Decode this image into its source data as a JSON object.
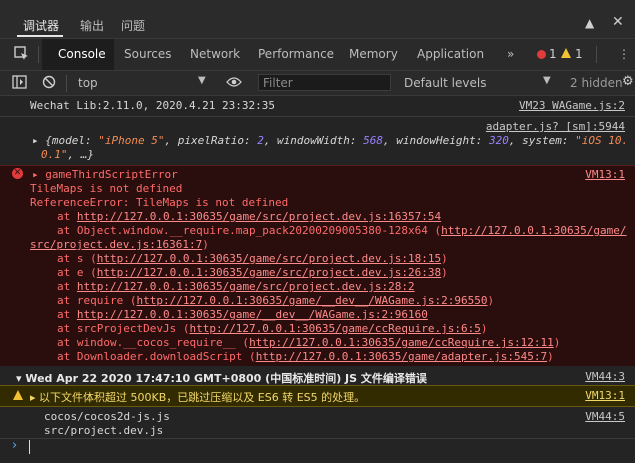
{
  "panel_tabs": [
    "调试器",
    "输出",
    "问题"
  ],
  "panel_icons": {
    "expand": "chevron-up-icon",
    "close": "close-icon"
  },
  "devtools": {
    "tabs": [
      "Console",
      "Sources",
      "Network",
      "Performance",
      "Memory",
      "Application"
    ],
    "error_count": "1",
    "warning_count": "1",
    "more": "⋮"
  },
  "filter_bar": {
    "context": "top",
    "filter_placeholder": "Filter",
    "levels": "Default levels",
    "hidden": "2 hidden"
  },
  "logs": {
    "lib_line": "Wechat Lib:2.11.0, 2020.4.21 23:32:35",
    "lib_src": "VM23 WAGame.js:2",
    "adapter_src": "adapter.js? [sm]:5944",
    "obj_prefix": "▸ {model: ",
    "obj_model": "\"iPhone 5\"",
    "obj_mid1": ", pixelRatio: ",
    "obj_ratio": "2",
    "obj_mid2": ", windowWidth: ",
    "obj_width": "568",
    "obj_mid3": ", windowHeight: ",
    "obj_height": "320",
    "obj_mid4": ", system: ",
    "obj_system": "\"iOS 10.",
    "obj_tail_val": "0.1\"",
    "obj_tail": ", …}",
    "error": {
      "title": "▸ gameThirdScriptError",
      "src": "VM13:1",
      "msg1": "TileMaps is not defined",
      "msg2": "ReferenceError: TileMaps is not defined",
      "s1_pre": "at ",
      "s1_link": "http://127.0.0.1:30635/game/src/project.dev.js:16357:54",
      "s2_pre": "at Object.window.__require.map_pack20200209005380-128x64 (",
      "s2_link": "http://127.0.0.1:30635/game/",
      "s2b_link": "src/project.dev.js:16361:7",
      "s2b_post": ")",
      "s3_pre": "at s (",
      "s3_link": "http://127.0.0.1:30635/game/src/project.dev.js:18:15",
      "s3_post": ")",
      "s4_pre": "at e (",
      "s4_link": "http://127.0.0.1:30635/game/src/project.dev.js:26:38",
      "s4_post": ")",
      "s5_pre": "at ",
      "s5_link": "http://127.0.0.1:30635/game/src/project.dev.js:28:2",
      "s6_pre": "at require (",
      "s6_link": "http://127.0.0.1:30635/game/__dev__/WAGame.js:2:96550",
      "s6_post": ")",
      "s7_pre": "at ",
      "s7_link": "http://127.0.0.1:30635/game/__dev__/WAGame.js:2:96160",
      "s8_pre": "at srcProjectDevJs (",
      "s8_link": "http://127.0.0.1:30635/game/ccRequire.js:6:5",
      "s8_post": ")",
      "s9_pre": "at window.__cocos_require__ (",
      "s9_link": "http://127.0.0.1:30635/game/ccRequire.js:12:11",
      "s9_post": ")",
      "s10_pre": "at Downloader.downloadScript (",
      "s10_link": "http://127.0.0.1:30635/game/adapter.js:545:7",
      "s10_post": ")"
    },
    "group_title": "▾ Wed Apr 22 2020 17:47:10 GMT+0800 (中国标准时间) JS 文件编译错误",
    "group_src": "VM44:3",
    "warning_text": "▸ 以下文件体积超过 500KB，已跳过压缩以及 ES6 转 ES5 的处理。",
    "warning_src": "VM13:1",
    "file1": "cocos/cocos2d-js.js",
    "file2": "src/project.dev.js",
    "files_src": "VM44:5",
    "prompt": "›"
  },
  "colors": {
    "error_bg": "#2a0d0d",
    "error_text": "#ff6b6b",
    "warning_bg": "#332b00",
    "warning_text": "#f1d86a",
    "accent": "#5aa5ff"
  }
}
